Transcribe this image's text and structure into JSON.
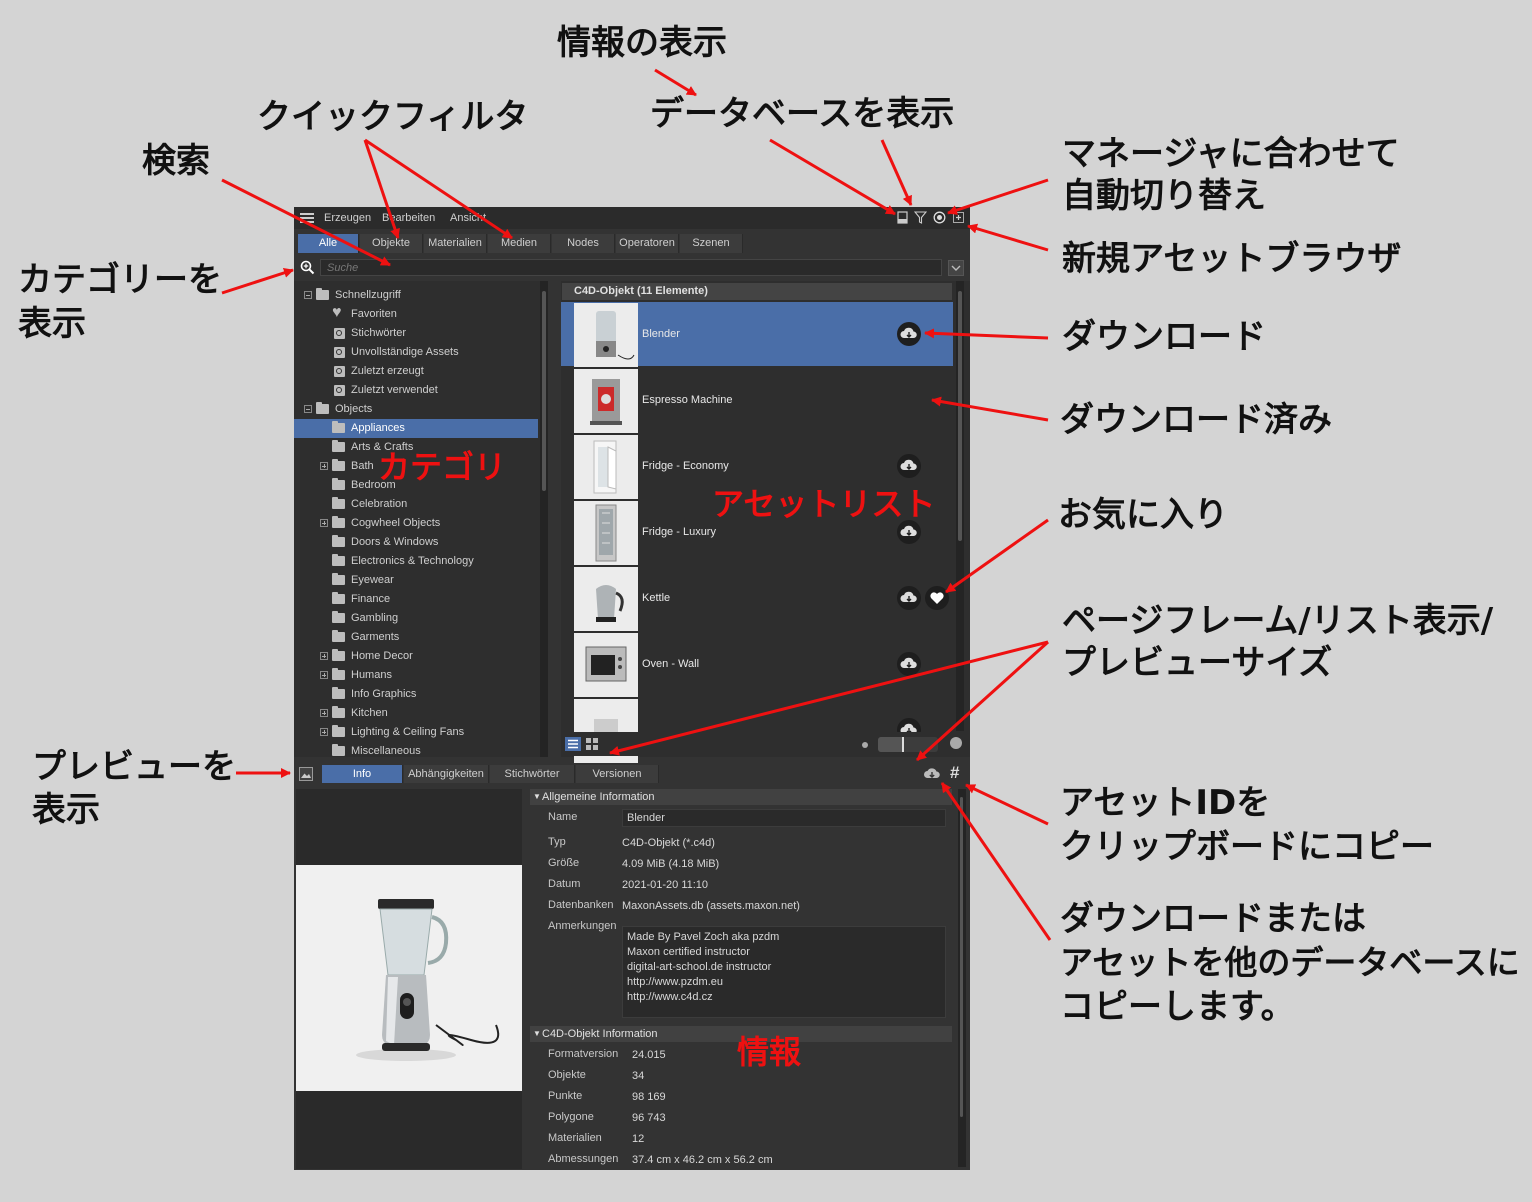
{
  "annotations": {
    "info_display": "情報の表示",
    "quick_filter": "クイックフィルタ",
    "show_database": "データベースを表示",
    "search": "検索",
    "auto_switch_line1": "マネージャに合わせて",
    "auto_switch_line2": "自動切り替え",
    "show_categories_line1": "カテゴリーを",
    "show_categories_line2": "表示",
    "new_browser": "新規アセットブラウザ",
    "download": "ダウンロード",
    "downloaded": "ダウンロード済み",
    "favorite": "お気に入り",
    "page_frame_line1": "ページフレーム/リスト表示/",
    "page_frame_line2": "プレビューサイズ",
    "show_preview_line1": "プレビューを",
    "show_preview_line2": "表示",
    "copy_id_line1": "アセットIDを",
    "copy_id_line2": "クリップボードにコピー",
    "copy_db_line1": "ダウンロードまたは",
    "copy_db_line2": "アセットを他のデータベースに",
    "copy_db_line3": "コピーします。",
    "category_red": "カテゴリ",
    "asset_list_red": "アセットリスト",
    "info_red": "情報"
  },
  "menu": [
    "Erzeugen",
    "Bearbeiten",
    "Ansicht"
  ],
  "tabs": [
    "Alle",
    "Objekte",
    "Materialien",
    "Medien",
    "Nodes",
    "Operatoren",
    "Szenen"
  ],
  "search_placeholder": "Suche",
  "tree": [
    {
      "label": "Schnellzugriff",
      "level": 0,
      "kind": "folder",
      "expander": "minus"
    },
    {
      "label": "Favoriten",
      "level": 1,
      "kind": "heart"
    },
    {
      "label": "Stichwörter",
      "level": 1,
      "kind": "search"
    },
    {
      "label": "Unvollständige Assets",
      "level": 1,
      "kind": "search"
    },
    {
      "label": "Zuletzt erzeugt",
      "level": 1,
      "kind": "search"
    },
    {
      "label": "Zuletzt verwendet",
      "level": 1,
      "kind": "search"
    },
    {
      "label": "Objects",
      "level": 0,
      "kind": "folder",
      "expander": "minus"
    },
    {
      "label": "Appliances",
      "level": 1,
      "kind": "folder",
      "selected": true
    },
    {
      "label": "Arts & Crafts",
      "level": 1,
      "kind": "folder"
    },
    {
      "label": "Bath",
      "level": 1,
      "kind": "folder",
      "expander": "plus"
    },
    {
      "label": "Bedroom",
      "level": 1,
      "kind": "folder"
    },
    {
      "label": "Celebration",
      "level": 1,
      "kind": "folder"
    },
    {
      "label": "Cogwheel Objects",
      "level": 1,
      "kind": "folder",
      "expander": "plus"
    },
    {
      "label": "Doors & Windows",
      "level": 1,
      "kind": "folder"
    },
    {
      "label": "Electronics & Technology",
      "level": 1,
      "kind": "folder"
    },
    {
      "label": "Eyewear",
      "level": 1,
      "kind": "folder"
    },
    {
      "label": "Finance",
      "level": 1,
      "kind": "folder"
    },
    {
      "label": "Gambling",
      "level": 1,
      "kind": "folder"
    },
    {
      "label": "Garments",
      "level": 1,
      "kind": "folder"
    },
    {
      "label": "Home Decor",
      "level": 1,
      "kind": "folder",
      "expander": "plus"
    },
    {
      "label": "Humans",
      "level": 1,
      "kind": "folder",
      "expander": "plus"
    },
    {
      "label": "Info Graphics",
      "level": 1,
      "kind": "folder"
    },
    {
      "label": "Kitchen",
      "level": 1,
      "kind": "folder",
      "expander": "plus"
    },
    {
      "label": "Lighting & Ceiling Fans",
      "level": 1,
      "kind": "folder",
      "expander": "plus"
    },
    {
      "label": "Miscellaneous",
      "level": 1,
      "kind": "folder"
    }
  ],
  "asset_header": "C4D-Objekt (11 Elemente)",
  "assets": [
    {
      "name": "Blender",
      "selected": true,
      "download": true,
      "favorite": false
    },
    {
      "name": "Espresso Machine",
      "download": false,
      "favorite": false
    },
    {
      "name": "Fridge - Economy",
      "download": true,
      "favorite": false
    },
    {
      "name": "Fridge - Luxury",
      "download": true,
      "favorite": false
    },
    {
      "name": "Kettle",
      "download": true,
      "favorite": true
    },
    {
      "name": "Oven - Wall",
      "download": true,
      "favorite": false
    },
    {
      "name": "",
      "download": true,
      "favorite": false
    }
  ],
  "info_tabs": [
    "Info",
    "Abhängigkeiten",
    "Stichwörter",
    "Versionen"
  ],
  "general_section": "Allgemeine Information",
  "general": {
    "name_label": "Name",
    "name_value": "Blender",
    "typ_label": "Typ",
    "typ_value": "C4D-Objekt (*.c4d)",
    "size_label": "Größe",
    "size_value": "4.09 MiB (4.18 MiB)",
    "date_label": "Datum",
    "date_value": "2021-01-20 11:10",
    "db_label": "Datenbanken",
    "db_value": "MaxonAssets.db (assets.maxon.net)",
    "notes_label": "Anmerkungen",
    "notes": [
      "Made By Pavel Zoch aka pzdm",
      "Maxon certified instructor",
      "digital-art-school.de instructor",
      "http://www.pzdm.eu",
      "http://www.c4d.cz"
    ]
  },
  "c4d_section": "C4D-Objekt Information",
  "c4d": [
    {
      "label": "Formatversion",
      "value": "24.015"
    },
    {
      "label": "Objekte",
      "value": "34"
    },
    {
      "label": "Punkte",
      "value": "98 169"
    },
    {
      "label": "Polygone",
      "value": "96 743"
    },
    {
      "label": "Materialien",
      "value": "12"
    },
    {
      "label": "Abmessungen",
      "value": "37.4 cm x 46.2 cm x 56.2 cm"
    }
  ],
  "hash_symbol": "#",
  "colors": {
    "accent": "#4a6ea8",
    "panel": "#333333",
    "annotation_red": "#ee1111"
  }
}
